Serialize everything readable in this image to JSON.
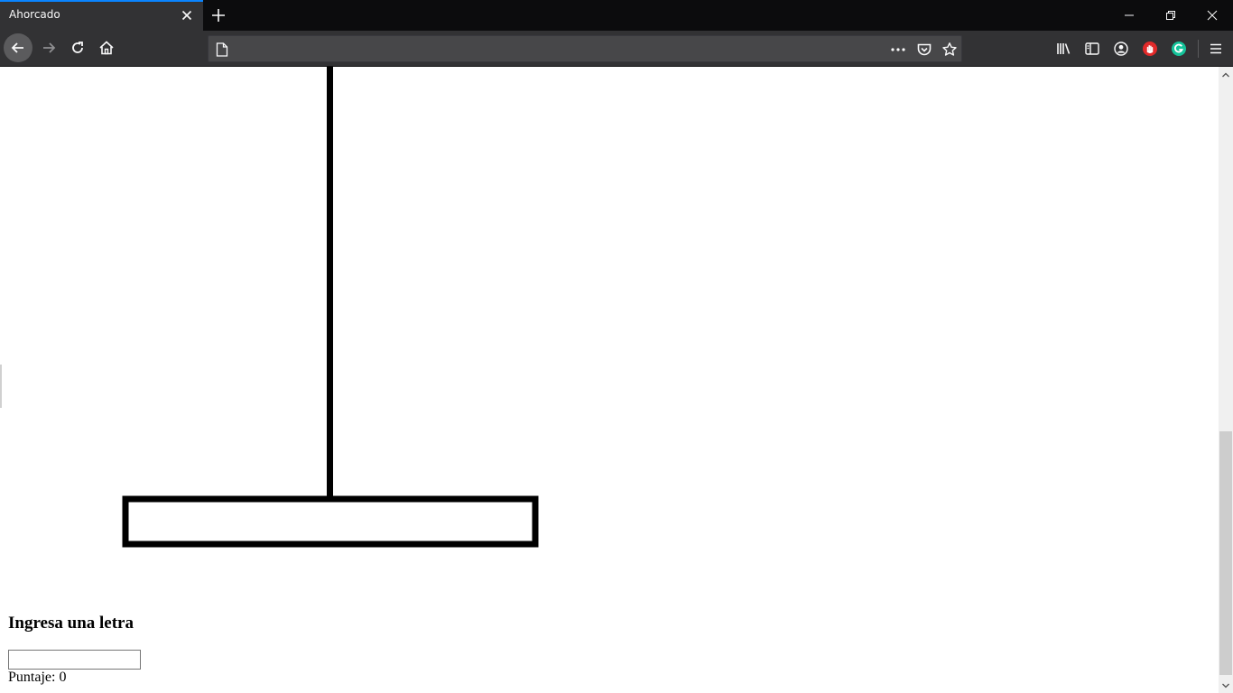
{
  "browser": {
    "tab": {
      "title": "Ahorcado"
    },
    "url": {
      "value": ""
    },
    "colors": {
      "tab_accent": "#0a84ff",
      "frame": "#0c0c0d",
      "toolbar": "#323234",
      "ext_red": "#e22a2a",
      "grammarly_green": "#15c39a"
    },
    "icons": [
      "back-arrow-icon",
      "forward-arrow-icon",
      "reload-icon",
      "home-icon",
      "page-icon",
      "more-dots-icon",
      "pocket-icon",
      "bookmark-star-icon",
      "library-icon",
      "sidebar-icon",
      "account-icon",
      "hand-stop-icon",
      "grammarly-icon",
      "hamburger-menu-icon"
    ]
  },
  "page": {
    "prompt": "Ingresa una letra",
    "input": {
      "value": ""
    },
    "score_label": "Puntaje:",
    "score_value": "0"
  }
}
